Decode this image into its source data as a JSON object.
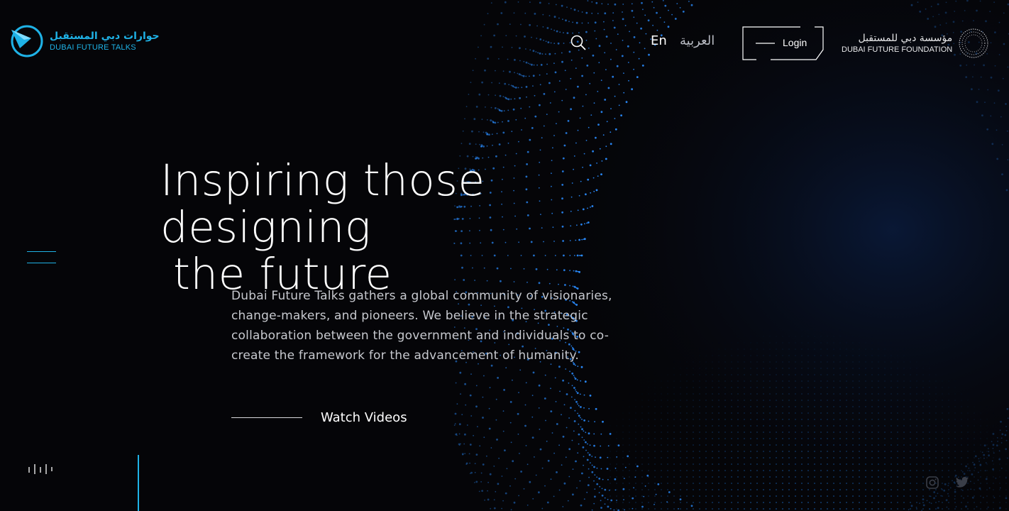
{
  "header": {
    "logo_left": {
      "arabic": "حوارات دبي المستقبل",
      "english": "DUBAI FUTURE TALKS",
      "color": "#1fb2e6"
    },
    "search_icon": "search-icon",
    "lang_en": "En",
    "lang_ar": "العربية",
    "login_label": "Login",
    "logo_right": {
      "arabic": "مؤسسة دبي للمستقبل",
      "english": "DUBAI FUTURE FOUNDATION"
    }
  },
  "hero": {
    "headline_line1": "Inspiring those designing",
    "headline_line2": "the future",
    "description": "Dubai Future Talks gathers a global community of visionaries, change-makers, and pioneers. We believe in the strategic collaboration between the government and individuals to co-create the framework for the advancement of humanity.",
    "cta_label": "Watch Videos"
  },
  "footer": {
    "audio_icon": "sound-bars-icon",
    "social": [
      "instagram-icon",
      "twitter-icon"
    ]
  },
  "colors": {
    "accent": "#1fb2e6",
    "background": "#050508",
    "particles": "#1a6fe0"
  }
}
